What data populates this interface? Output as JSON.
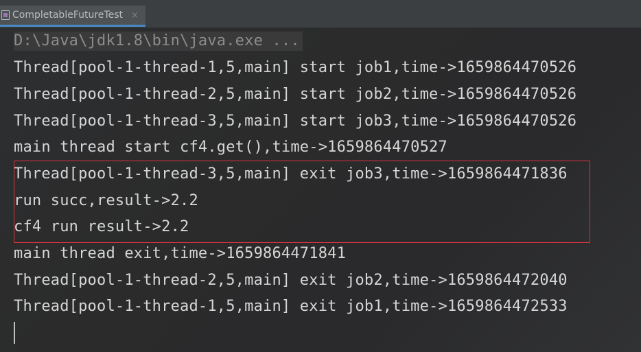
{
  "tab": {
    "label": "CompletableFutureTest",
    "close": "×",
    "icon": "java-class-icon"
  },
  "console": {
    "command": "D:\\Java\\jdk1.8\\bin\\java.exe ...",
    "lines": [
      "Thread[pool-1-thread-1,5,main] start job1,time->1659864470526",
      "Thread[pool-1-thread-2,5,main] start job2,time->1659864470526",
      "Thread[pool-1-thread-3,5,main] start job3,time->1659864470526",
      "main thread start cf4.get(),time->1659864470527",
      "Thread[pool-1-thread-3,5,main] exit job3,time->1659864471836",
      "run succ,result->2.2",
      "cf4 run result->2.2",
      "main thread exit,time->1659864471841",
      "Thread[pool-1-thread-2,5,main] exit job2,time->1659864472040",
      "Thread[pool-1-thread-1,5,main] exit job1,time->1659864472533"
    ]
  },
  "colors": {
    "highlight_border": "#d9333f",
    "text": "#d6d6d6",
    "command_text": "#8c8c8c"
  }
}
